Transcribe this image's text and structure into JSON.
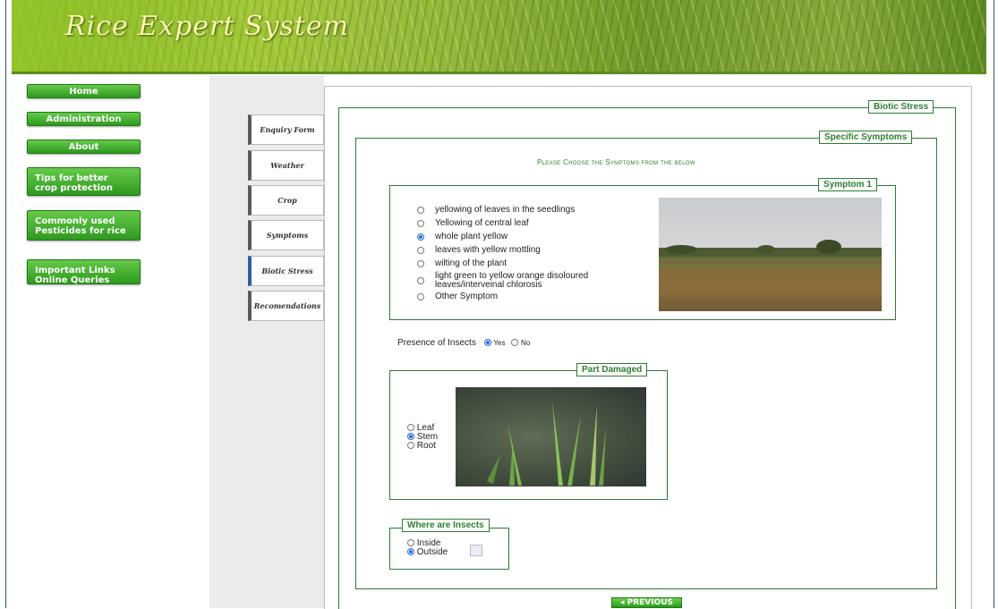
{
  "header": {
    "title": "Rice Expert System"
  },
  "left_nav": [
    {
      "label": "Home"
    },
    {
      "label": "Administration"
    },
    {
      "label": "About"
    },
    {
      "label": "Tips for better crop protection",
      "lines": [
        "Tips for better",
        "crop protection"
      ]
    },
    {
      "label": "Commonly used Pesticides for rice",
      "lines": [
        "Commonly used",
        "Pesticides for rice"
      ]
    },
    {
      "label": "Important Links Online Queries",
      "lines": [
        "Important Links",
        "Online Queries"
      ]
    }
  ],
  "tabs": [
    {
      "label": "Enquiry Form"
    },
    {
      "label": "Weather"
    },
    {
      "label": "Crop"
    },
    {
      "label": "Symptoms"
    },
    {
      "label": "Biotic Stress",
      "active": true
    },
    {
      "label": "Recomendations"
    }
  ],
  "biotic_stress": {
    "legend": "Biotic Stress"
  },
  "specific_symptoms": {
    "legend": "Specific Symptoms",
    "instruction": "Please Choose the Symptoms from the below"
  },
  "symptom1": {
    "legend": "Symptom 1",
    "options": [
      {
        "label": "yellowing of leaves in the seedlings",
        "selected": false
      },
      {
        "label": "Yellowing of central leaf",
        "selected": false
      },
      {
        "label": "whole plant yellow",
        "selected": true
      },
      {
        "label": "leaves with yellow mottling",
        "selected": false
      },
      {
        "label": "wilting of the plant",
        "selected": false
      },
      {
        "label_line1": "light green to yellow orange disoloured",
        "label_line2": "leaves/interveinal chlorosis",
        "selected": false
      },
      {
        "label": "Other Symptom",
        "selected": false
      }
    ]
  },
  "insects": {
    "label": "Presence of Insects",
    "yes": "Yes",
    "no": "No",
    "selected": "Yes"
  },
  "part_damaged": {
    "legend": "Part Damaged",
    "options": [
      {
        "label": "Leaf",
        "selected": false
      },
      {
        "label": "Stem",
        "selected": true
      },
      {
        "label": "Root",
        "selected": false
      }
    ]
  },
  "where_insects": {
    "legend": "Where are Insects",
    "options": [
      {
        "label": "Inside",
        "selected": false
      },
      {
        "label": "Outside",
        "selected": true
      }
    ]
  },
  "buttons": {
    "previous": "◂ PREVIOUS"
  },
  "colors": {
    "accent_green": "#2e7d32",
    "nav_green": "#3aa82a",
    "frame_blue": "#2d4f8a"
  }
}
